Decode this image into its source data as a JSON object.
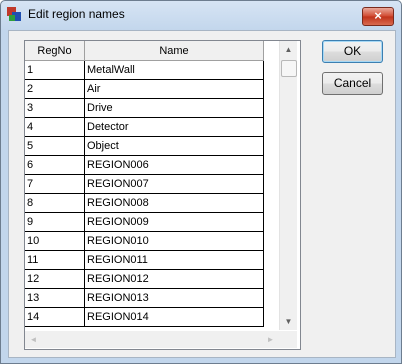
{
  "window": {
    "title": "Edit region names",
    "close_label": "×"
  },
  "table": {
    "columns": [
      "RegNo",
      "Name"
    ],
    "rows": [
      [
        "1",
        "MetalWall"
      ],
      [
        "2",
        "Air"
      ],
      [
        "3",
        "Drive"
      ],
      [
        "4",
        "Detector"
      ],
      [
        "5",
        "Object"
      ],
      [
        "6",
        "REGION006"
      ],
      [
        "7",
        "REGION007"
      ],
      [
        "8",
        "REGION008"
      ],
      [
        "9",
        "REGION009"
      ],
      [
        "10",
        "REGION010"
      ],
      [
        "11",
        "REGION011"
      ],
      [
        "12",
        "REGION012"
      ],
      [
        "13",
        "REGION013"
      ],
      [
        "14",
        "REGION014"
      ]
    ]
  },
  "buttons": {
    "ok_label": "OK",
    "cancel_label": "Cancel"
  },
  "scroll": {
    "up": "▲",
    "down": "▼",
    "left": "◄",
    "right": "►"
  }
}
